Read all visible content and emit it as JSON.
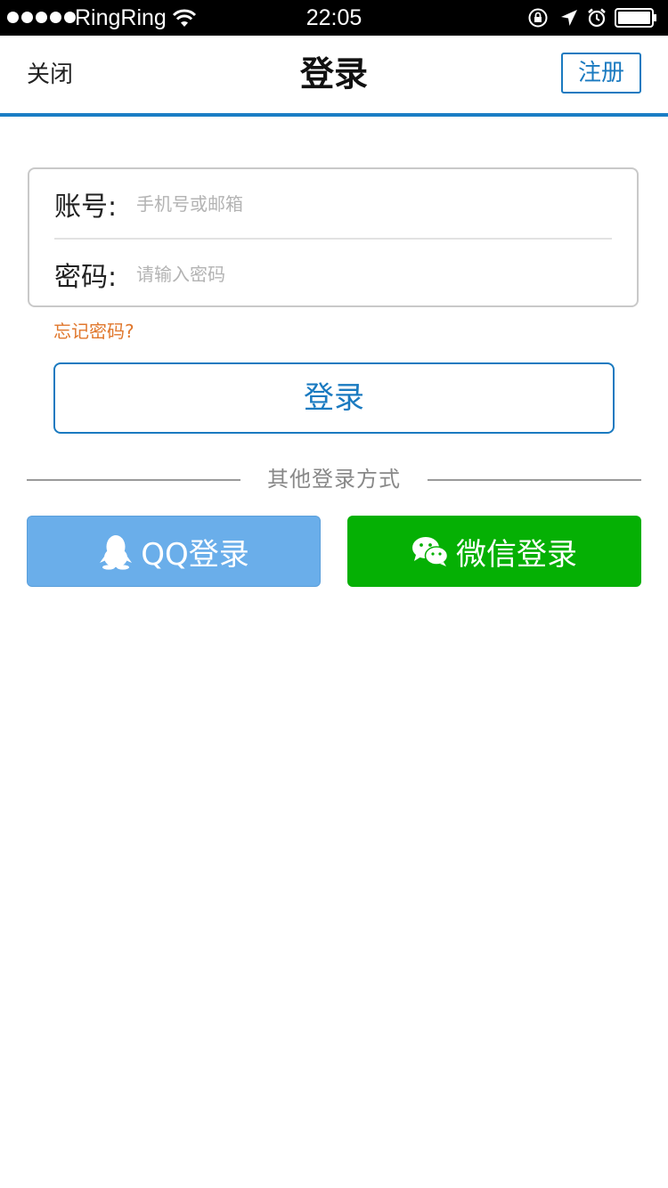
{
  "status_bar": {
    "carrier": "RingRing",
    "time": "22:05",
    "signal_bars": 5,
    "icons": [
      "wifi-icon",
      "rotation-lock-icon",
      "location-icon",
      "alarm-icon",
      "battery-icon"
    ]
  },
  "nav": {
    "close_label": "关闭",
    "title": "登录",
    "register_label": "注册"
  },
  "form": {
    "account_label": "账号:",
    "account_placeholder": "手机号或邮箱",
    "account_value": "",
    "password_label": "密码:",
    "password_placeholder": "请输入密码",
    "password_value": "",
    "forgot_label": "忘记密码?",
    "login_label": "登录"
  },
  "other_login": {
    "title": "其他登录方式",
    "qq_label": "QQ登录",
    "wechat_label": "微信登录"
  },
  "colors": {
    "accent": "#1a7ac0",
    "forgot": "#e0772c",
    "qq_button": "#6aaeea",
    "wechat_button": "#05b004"
  }
}
